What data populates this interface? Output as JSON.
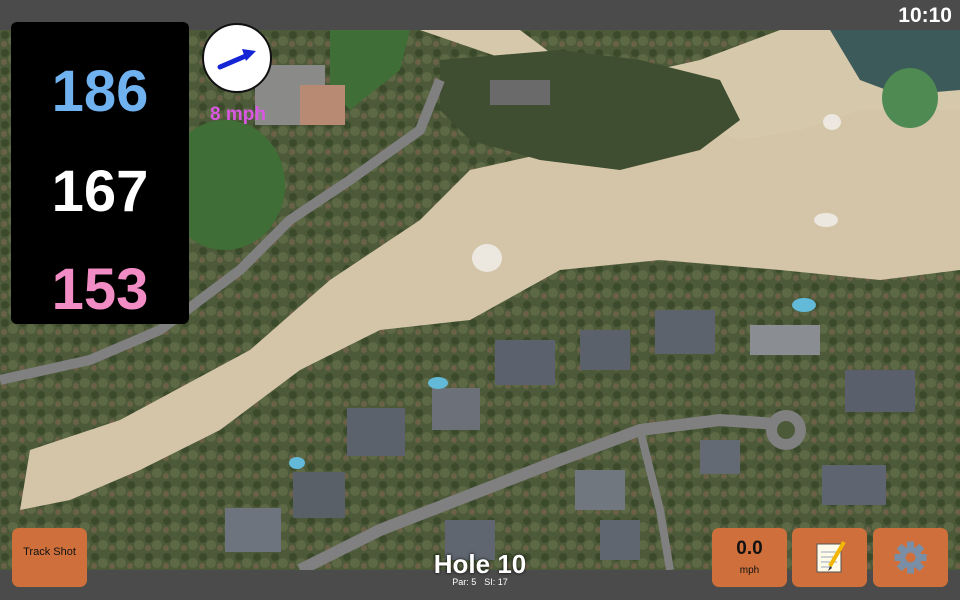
{
  "status_bar": {
    "time": "10:10"
  },
  "distances": {
    "back": "186",
    "center": "167",
    "front": "153"
  },
  "wind": {
    "speed": "8 mph",
    "icon": "wind-arrow-icon"
  },
  "hole": {
    "title": "Hole 10",
    "par": "Par: 5",
    "si": "SI: 17"
  },
  "buttons": {
    "track_shot": "Track Shot",
    "speed_value": "0.0",
    "speed_unit": "mph",
    "notes_icon": "notepad-icon",
    "settings_icon": "gear-icon"
  },
  "colors": {
    "back_distance": "#6fb2ef",
    "center_distance": "#ffffff",
    "front_distance": "#f28cc4",
    "wind_text": "#d957e2",
    "button": "#cf703c",
    "bar": "#4b4b4b"
  }
}
